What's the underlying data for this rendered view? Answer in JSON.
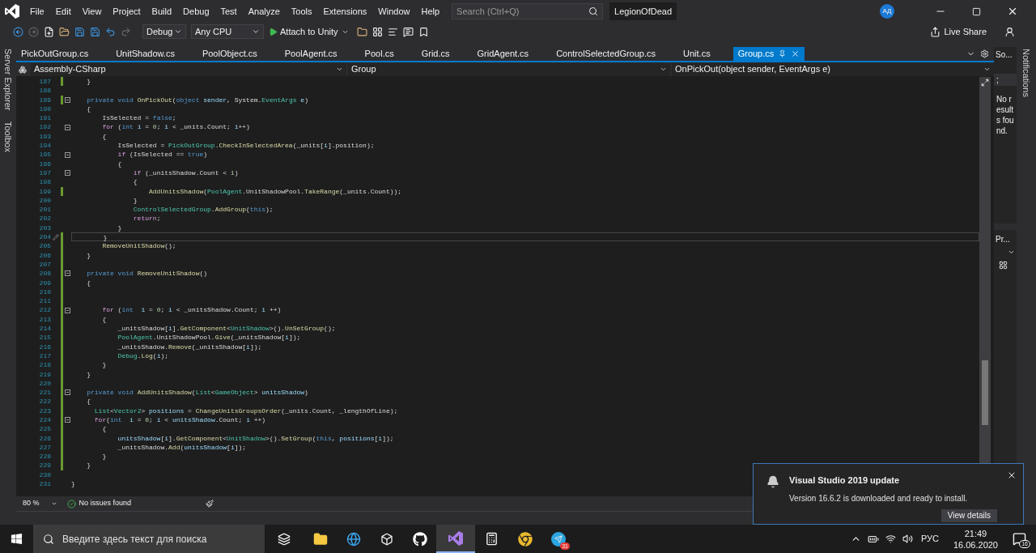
{
  "title_bar": {
    "menu": [
      "File",
      "Edit",
      "View",
      "Project",
      "Build",
      "Debug",
      "Test",
      "Analyze",
      "Tools",
      "Extensions",
      "Window",
      "Help"
    ],
    "search": {
      "placeholder": "Search (Ctrl+Q)"
    },
    "solution": "LegionOfDead",
    "avatar": "АД"
  },
  "toolbar": {
    "configuration": "Debug",
    "platform": "Any CPU",
    "run_target": "Attach to Unity",
    "live_share": "Live Share"
  },
  "side_tabs": [
    "Server Explorer",
    "Toolbox"
  ],
  "document_tabs": [
    {
      "label": "PickOutGroup.cs",
      "selected": false
    },
    {
      "label": "UnitShadow.cs",
      "selected": false
    },
    {
      "label": "PoolObject.cs",
      "selected": false
    },
    {
      "label": "PoolAgent.cs",
      "selected": false
    },
    {
      "label": "Pool.cs",
      "selected": false
    },
    {
      "label": "Grid.cs",
      "selected": false
    },
    {
      "label": "GridAgent.cs",
      "selected": false
    },
    {
      "label": "ControlSelectedGroup.cs",
      "selected": false
    },
    {
      "label": "Unit.cs",
      "selected": false
    },
    {
      "label": "Group.cs",
      "selected": true
    }
  ],
  "navigation": {
    "project": "Assembly-CSharp",
    "type": "Group",
    "member": "OnPickOut(object sender, EventArgs e)"
  },
  "code_lines": [
    {
      "number": "187",
      "changed": true,
      "foldable": false,
      "current": false,
      "tokens": [
        {
          "kind": "plain",
          "text": "    }"
        }
      ]
    },
    {
      "number": "188",
      "changed": false,
      "foldable": false,
      "current": false
    },
    {
      "number": "189",
      "changed": true,
      "foldable": true,
      "current": false,
      "tokens": [
        {
          "kind": "keyword",
          "text": "    private void "
        },
        {
          "kind": "method",
          "text": "OnPickOut"
        },
        {
          "kind": "plain",
          "text": "("
        },
        {
          "kind": "keyword",
          "text": "object "
        },
        {
          "kind": "var",
          "text": "sender"
        },
        {
          "kind": "plain",
          "text": ", System."
        },
        {
          "kind": "type",
          "text": "EventArgs"
        },
        {
          "kind": "var",
          "text": " e"
        },
        {
          "kind": "plain",
          "text": ")"
        }
      ]
    },
    {
      "number": "190",
      "changed": false,
      "foldable": false,
      "current": false,
      "tokens": [
        {
          "kind": "plain",
          "text": "    {"
        }
      ]
    },
    {
      "number": "191",
      "changed": false,
      "foldable": false,
      "current": false,
      "tokens": [
        {
          "kind": "plain",
          "text": "        IsSelected = "
        },
        {
          "kind": "keyword",
          "text": "false"
        },
        {
          "kind": "plain",
          "text": ";"
        }
      ]
    },
    {
      "number": "192",
      "changed": false,
      "foldable": true,
      "current": false,
      "tokens": [
        {
          "kind": "control",
          "text": "        for"
        },
        {
          "kind": "plain",
          "text": " ("
        },
        {
          "kind": "keyword",
          "text": "int "
        },
        {
          "kind": "var",
          "text": "i"
        },
        {
          "kind": "plain",
          "text": " = "
        },
        {
          "kind": "number",
          "text": "0"
        },
        {
          "kind": "plain",
          "text": "; "
        },
        {
          "kind": "var",
          "text": "i"
        },
        {
          "kind": "plain",
          "text": " < _units.Count; "
        },
        {
          "kind": "var",
          "text": "i"
        },
        {
          "kind": "plain",
          "text": "++)"
        }
      ]
    },
    {
      "number": "193",
      "changed": false,
      "foldable": false,
      "current": false,
      "tokens": [
        {
          "kind": "plain",
          "text": "        {"
        }
      ]
    },
    {
      "number": "194",
      "changed": false,
      "foldable": false,
      "current": false,
      "tokens": [
        {
          "kind": "plain",
          "text": "            IsSelected = "
        },
        {
          "kind": "type",
          "text": "PickOutGroup"
        },
        {
          "kind": "plain",
          "text": "."
        },
        {
          "kind": "method",
          "text": "CheckInSelectedArea"
        },
        {
          "kind": "plain",
          "text": "(_units["
        },
        {
          "kind": "var",
          "text": "i"
        },
        {
          "kind": "plain",
          "text": "].position);"
        }
      ]
    },
    {
      "number": "195",
      "changed": false,
      "foldable": true,
      "current": false,
      "tokens": [
        {
          "kind": "control",
          "text": "            if"
        },
        {
          "kind": "plain",
          "text": " (IsSelected == "
        },
        {
          "kind": "keyword",
          "text": "true"
        },
        {
          "kind": "plain",
          "text": ")"
        }
      ]
    },
    {
      "number": "196",
      "changed": false,
      "foldable": false,
      "current": false,
      "tokens": [
        {
          "kind": "plain",
          "text": "            {"
        }
      ]
    },
    {
      "number": "197",
      "changed": false,
      "foldable": true,
      "current": false,
      "tokens": [
        {
          "kind": "control",
          "text": "                if"
        },
        {
          "kind": "plain",
          "text": " (_unitsShadow.Count < "
        },
        {
          "kind": "number",
          "text": "1"
        },
        {
          "kind": "plain",
          "text": ")"
        }
      ]
    },
    {
      "number": "198",
      "changed": false,
      "foldable": false,
      "current": false,
      "tokens": [
        {
          "kind": "plain",
          "text": "                {"
        }
      ]
    },
    {
      "number": "199",
      "changed": true,
      "foldable": false,
      "current": false,
      "tokens": [
        {
          "kind": "method",
          "text": "                    AddUnitsShadow"
        },
        {
          "kind": "plain",
          "text": "("
        },
        {
          "kind": "type",
          "text": "PoolAgent"
        },
        {
          "kind": "plain",
          "text": ".UnitShadowPool."
        },
        {
          "kind": "method",
          "text": "TakeRange"
        },
        {
          "kind": "plain",
          "text": "(_units.Count));"
        }
      ]
    },
    {
      "number": "200",
      "changed": false,
      "foldable": false,
      "current": false,
      "tokens": [
        {
          "kind": "plain",
          "text": "                }"
        }
      ]
    },
    {
      "number": "201",
      "changed": false,
      "foldable": false,
      "current": false,
      "tokens": [
        {
          "kind": "type",
          "text": "                ControlSelectedGroup"
        },
        {
          "kind": "plain",
          "text": "."
        },
        {
          "kind": "method",
          "text": "AddGroup"
        },
        {
          "kind": "plain",
          "text": "("
        },
        {
          "kind": "keyword",
          "text": "this"
        },
        {
          "kind": "plain",
          "text": ");"
        }
      ]
    },
    {
      "number": "202",
      "changed": false,
      "foldable": false,
      "current": false,
      "tokens": [
        {
          "kind": "control",
          "text": "                return"
        },
        {
          "kind": "plain",
          "text": ";"
        }
      ]
    },
    {
      "number": "203",
      "changed": false,
      "foldable": false,
      "current": false,
      "tokens": [
        {
          "kind": "plain",
          "text": "            }"
        }
      ]
    },
    {
      "number": "204",
      "changed": true,
      "foldable": false,
      "current": true,
      "tokens": [
        {
          "kind": "plain",
          "text": "        }"
        }
      ]
    },
    {
      "number": "205",
      "changed": true,
      "foldable": false,
      "current": false,
      "tokens": [
        {
          "kind": "method",
          "text": "        RemoveUnitShadow"
        },
        {
          "kind": "plain",
          "text": "();"
        }
      ]
    },
    {
      "number": "206",
      "changed": true,
      "foldable": false,
      "current": false,
      "tokens": [
        {
          "kind": "plain",
          "text": "    }"
        }
      ]
    },
    {
      "number": "207",
      "changed": true,
      "foldable": false,
      "current": false
    },
    {
      "number": "208",
      "changed": true,
      "foldable": true,
      "current": false,
      "tokens": [
        {
          "kind": "keyword",
          "text": "    private void "
        },
        {
          "kind": "method",
          "text": "RemoveUnitShadow"
        },
        {
          "kind": "plain",
          "text": "()"
        }
      ]
    },
    {
      "number": "209",
      "changed": true,
      "foldable": false,
      "current": false,
      "tokens": [
        {
          "kind": "plain",
          "text": "    {"
        }
      ]
    },
    {
      "number": "210",
      "changed": true,
      "foldable": false,
      "current": false
    },
    {
      "number": "211",
      "changed": true,
      "foldable": false,
      "current": false
    },
    {
      "number": "212",
      "changed": true,
      "foldable": true,
      "current": false,
      "tokens": [
        {
          "kind": "control",
          "text": "        for"
        },
        {
          "kind": "plain",
          "text": " ("
        },
        {
          "kind": "keyword",
          "text": "int  "
        },
        {
          "kind": "var",
          "text": "i"
        },
        {
          "kind": "plain",
          "text": " = "
        },
        {
          "kind": "number",
          "text": "0"
        },
        {
          "kind": "plain",
          "text": "; "
        },
        {
          "kind": "var",
          "text": "i"
        },
        {
          "kind": "plain",
          "text": " < _unitsShadow.Count; "
        },
        {
          "kind": "var",
          "text": "i"
        },
        {
          "kind": "plain",
          "text": " ++)"
        }
      ]
    },
    {
      "number": "213",
      "changed": true,
      "foldable": false,
      "current": false,
      "tokens": [
        {
          "kind": "plain",
          "text": "        {"
        }
      ]
    },
    {
      "number": "214",
      "changed": true,
      "foldable": false,
      "current": false,
      "tokens": [
        {
          "kind": "plain",
          "text": "            _unitsShadow["
        },
        {
          "kind": "var",
          "text": "i"
        },
        {
          "kind": "plain",
          "text": "]."
        },
        {
          "kind": "method",
          "text": "GetComponent"
        },
        {
          "kind": "plain",
          "text": "<"
        },
        {
          "kind": "type",
          "text": "UnitShadow"
        },
        {
          "kind": "plain",
          "text": ">()."
        },
        {
          "kind": "method",
          "text": "UnSetGroup"
        },
        {
          "kind": "plain",
          "text": "();"
        }
      ]
    },
    {
      "number": "215",
      "changed": true,
      "foldable": false,
      "current": false,
      "tokens": [
        {
          "kind": "type",
          "text": "            PoolAgent"
        },
        {
          "kind": "plain",
          "text": ".UnitShadowPool."
        },
        {
          "kind": "method",
          "text": "Give"
        },
        {
          "kind": "plain",
          "text": "(_unitsShadow["
        },
        {
          "kind": "var",
          "text": "i"
        },
        {
          "kind": "plain",
          "text": "]);"
        }
      ]
    },
    {
      "number": "216",
      "changed": true,
      "foldable": false,
      "current": false,
      "tokens": [
        {
          "kind": "plain",
          "text": "            _unitsShadow."
        },
        {
          "kind": "method",
          "text": "Remove"
        },
        {
          "kind": "plain",
          "text": "(_unitsShadow["
        },
        {
          "kind": "var",
          "text": "i"
        },
        {
          "kind": "plain",
          "text": "]);"
        }
      ]
    },
    {
      "number": "217",
      "changed": true,
      "foldable": false,
      "current": false,
      "tokens": [
        {
          "kind": "type",
          "text": "            Debug"
        },
        {
          "kind": "plain",
          "text": "."
        },
        {
          "kind": "method",
          "text": "Log"
        },
        {
          "kind": "plain",
          "text": "("
        },
        {
          "kind": "var",
          "text": "i"
        },
        {
          "kind": "plain",
          "text": ");"
        }
      ]
    },
    {
      "number": "218",
      "changed": true,
      "foldable": false,
      "current": false,
      "tokens": [
        {
          "kind": "plain",
          "text": "        }"
        }
      ]
    },
    {
      "number": "219",
      "changed": true,
      "foldable": false,
      "current": false,
      "tokens": [
        {
          "kind": "plain",
          "text": "    }"
        }
      ]
    },
    {
      "number": "220",
      "changed": true,
      "foldable": false,
      "current": false
    },
    {
      "number": "221",
      "changed": true,
      "foldable": true,
      "current": false,
      "tokens": [
        {
          "kind": "keyword",
          "text": "    private void "
        },
        {
          "kind": "method",
          "text": "AddUnitsShadow"
        },
        {
          "kind": "plain",
          "text": "("
        },
        {
          "kind": "type",
          "text": "List"
        },
        {
          "kind": "plain",
          "text": "<"
        },
        {
          "kind": "type",
          "text": "GameObject"
        },
        {
          "kind": "plain",
          "text": "> "
        },
        {
          "kind": "var",
          "text": "unitsShadow"
        },
        {
          "kind": "plain",
          "text": ")"
        }
      ]
    },
    {
      "number": "222",
      "changed": true,
      "foldable": false,
      "current": false,
      "tokens": [
        {
          "kind": "plain",
          "text": "    {"
        }
      ]
    },
    {
      "number": "223",
      "changed": true,
      "foldable": false,
      "current": false,
      "tokens": [
        {
          "kind": "type",
          "text": "      List"
        },
        {
          "kind": "plain",
          "text": "<"
        },
        {
          "kind": "type",
          "text": "Vector2"
        },
        {
          "kind": "plain",
          "text": "> "
        },
        {
          "kind": "var",
          "text": "positions"
        },
        {
          "kind": "plain",
          "text": " = "
        },
        {
          "kind": "method",
          "text": "ChangeUnitsGroupsOrder"
        },
        {
          "kind": "plain",
          "text": "(_units.Count, _lengthOfLine);"
        }
      ]
    },
    {
      "number": "224",
      "changed": true,
      "foldable": true,
      "current": false,
      "tokens": [
        {
          "kind": "control",
          "text": "      for"
        },
        {
          "kind": "plain",
          "text": "("
        },
        {
          "kind": "keyword",
          "text": "int  "
        },
        {
          "kind": "var",
          "text": "i"
        },
        {
          "kind": "plain",
          "text": " = "
        },
        {
          "kind": "number",
          "text": "0"
        },
        {
          "kind": "plain",
          "text": "; "
        },
        {
          "kind": "var",
          "text": "i"
        },
        {
          "kind": "plain",
          "text": " < "
        },
        {
          "kind": "var",
          "text": "unitsShadow"
        },
        {
          "kind": "plain",
          "text": ".Count; "
        },
        {
          "kind": "var",
          "text": "i"
        },
        {
          "kind": "plain",
          "text": " ++)"
        }
      ]
    },
    {
      "number": "225",
      "changed": true,
      "foldable": false,
      "current": false,
      "tokens": [
        {
          "kind": "plain",
          "text": "        {"
        }
      ]
    },
    {
      "number": "226",
      "changed": true,
      "foldable": false,
      "current": false,
      "tokens": [
        {
          "kind": "var",
          "text": "            unitsShadow"
        },
        {
          "kind": "plain",
          "text": "["
        },
        {
          "kind": "var",
          "text": "i"
        },
        {
          "kind": "plain",
          "text": "]."
        },
        {
          "kind": "method",
          "text": "GetComponent"
        },
        {
          "kind": "plain",
          "text": "<"
        },
        {
          "kind": "type",
          "text": "UnitShadow"
        },
        {
          "kind": "plain",
          "text": ">()."
        },
        {
          "kind": "method",
          "text": "SetGroup"
        },
        {
          "kind": "plain",
          "text": "("
        },
        {
          "kind": "keyword",
          "text": "this"
        },
        {
          "kind": "plain",
          "text": ", "
        },
        {
          "kind": "var",
          "text": "positions"
        },
        {
          "kind": "plain",
          "text": "["
        },
        {
          "kind": "var",
          "text": "i"
        },
        {
          "kind": "plain",
          "text": "]);"
        }
      ]
    },
    {
      "number": "227",
      "changed": true,
      "foldable": false,
      "current": false,
      "tokens": [
        {
          "kind": "plain",
          "text": "            _unitsShadow."
        },
        {
          "kind": "method",
          "text": "Add"
        },
        {
          "kind": "plain",
          "text": "("
        },
        {
          "kind": "var",
          "text": "unitsShadow"
        },
        {
          "kind": "plain",
          "text": "["
        },
        {
          "kind": "var",
          "text": "i"
        },
        {
          "kind": "plain",
          "text": "]);"
        }
      ]
    },
    {
      "number": "228",
      "changed": true,
      "foldable": false,
      "current": false,
      "tokens": [
        {
          "kind": "plain",
          "text": "        }"
        }
      ]
    },
    {
      "number": "229",
      "changed": true,
      "foldable": false,
      "current": false,
      "tokens": [
        {
          "kind": "plain",
          "text": "    }"
        }
      ]
    },
    {
      "number": "230",
      "changed": false,
      "foldable": false,
      "current": false
    },
    {
      "number": "231",
      "changed": false,
      "foldable": false,
      "current": false,
      "tokens": [
        {
          "kind": "plain",
          "text": "}"
        }
      ]
    }
  ],
  "status_bar": {
    "zoom": "80 %",
    "issues": "No issues found"
  },
  "solution_panel": {
    "title": "So...",
    "search_value": ";",
    "message": "No results found."
  },
  "properties_panel": {
    "title": "Pr..."
  },
  "notifications_tab": "Notifications",
  "toast": {
    "title": "Visual Studio 2019 update",
    "message": "Version 16.6.2 is downloaded and ready to install.",
    "button": "View details"
  },
  "taskbar": {
    "search": {
      "placeholder": "Введите здесь текст для поиска"
    },
    "telegram_badge": "31",
    "language": "РУС",
    "time": "21:49",
    "date": "16.06.2020",
    "notification_count": "16"
  }
}
